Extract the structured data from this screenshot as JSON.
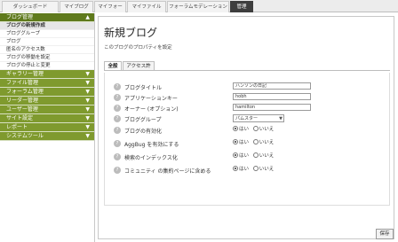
{
  "top_tabs": [
    "ダッシュボード",
    "マイブログ",
    "マイフォー",
    "マイファイル",
    "フォーラムモデレーション",
    "管理"
  ],
  "sidebar": {
    "sections": [
      {
        "label": "ブログ管理",
        "items": [
          "ブログの新規作成",
          "ブロググループ",
          "ブログ",
          "匿名のアクセス数",
          "ブログの移動を設定",
          "ブログの停止と変更"
        ]
      },
      {
        "label": "ギャラリー管理"
      },
      {
        "label": "ファイル管理"
      },
      {
        "label": "フォーラム管理"
      },
      {
        "label": "リーダー管理"
      },
      {
        "label": "ユーザー管理"
      },
      {
        "label": "サイト設定"
      },
      {
        "label": "レポート"
      },
      {
        "label": "システムツール"
      }
    ]
  },
  "main": {
    "title": "新規ブログ",
    "subtitle": "このブログのプロパティを設定",
    "tabs": [
      "全般",
      "アクセス許"
    ],
    "fields": [
      {
        "label": "ブログタイトル",
        "value": "ハンソンの日記"
      },
      {
        "label": "アプリケーションキー",
        "value": "hobh"
      },
      {
        "label": "オーナー (オプション)",
        "value": "hamilton"
      },
      {
        "label": "ブロググループ",
        "value": "パムスター"
      }
    ],
    "radio_rows": [
      {
        "label": "ブログの有効化",
        "yes": "はい",
        "no": "いいえ",
        "selected": "yes"
      },
      {
        "label": "AggBug を有効にする",
        "yes": "はい",
        "no": "いいえ",
        "selected": "yes"
      },
      {
        "label": "検索のインデックス化",
        "yes": "はい",
        "no": "いいえ",
        "selected": "yes"
      },
      {
        "label": "コミュニティ の集約ページに含める",
        "yes": "はい",
        "no": "いいえ",
        "selected": "yes"
      }
    ],
    "save_label": "保存"
  }
}
